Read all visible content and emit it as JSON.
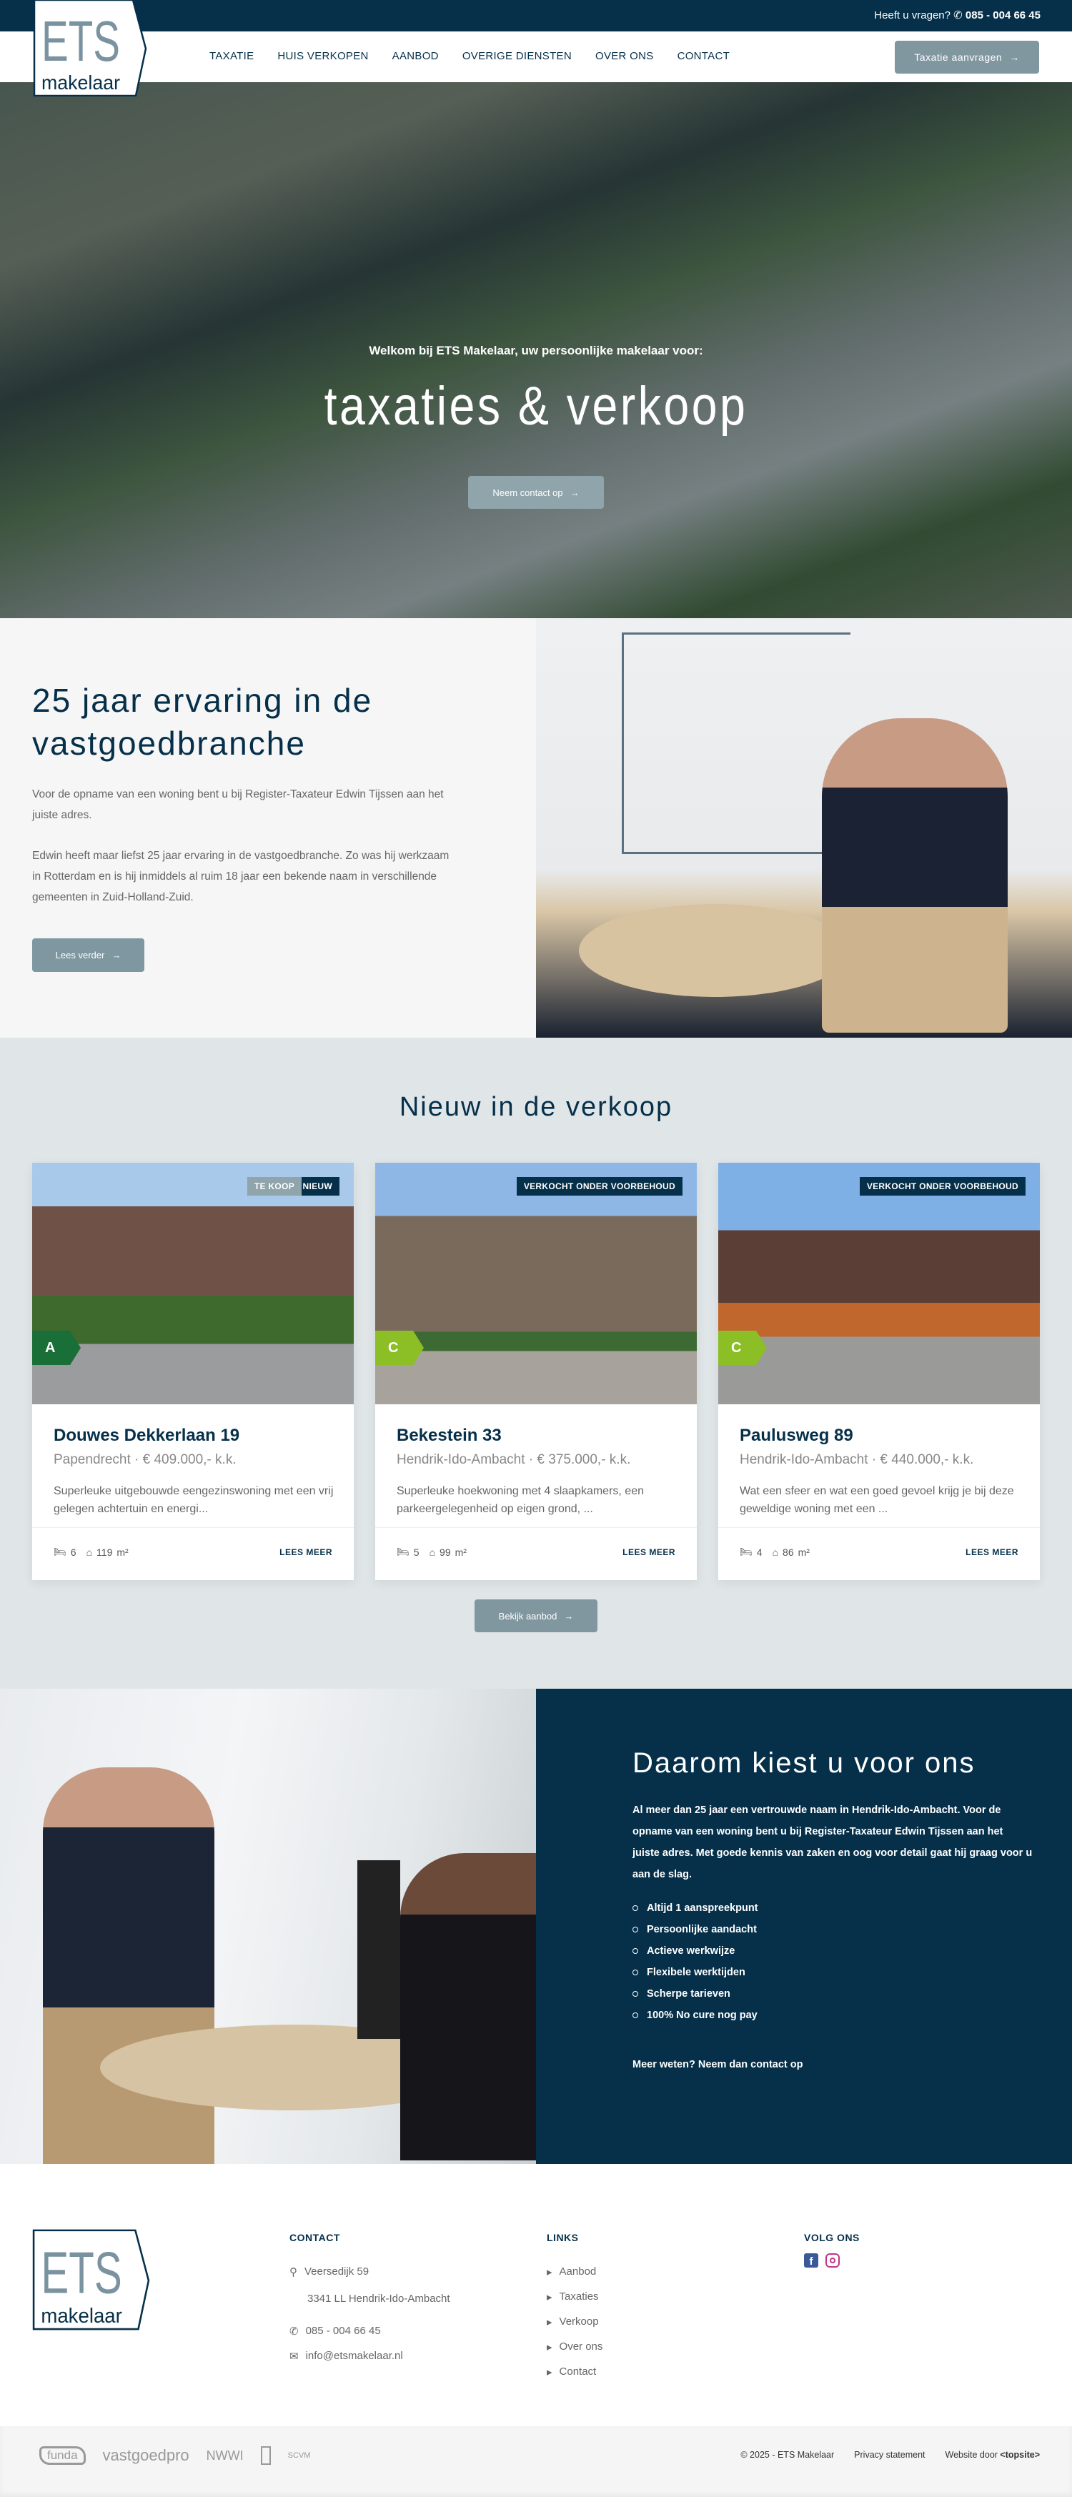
{
  "topbar": {
    "question": "Heeft u vragen?",
    "phone": "085 - 004 66 45"
  },
  "logo": {
    "big": "ETS",
    "small": "makelaar"
  },
  "nav": {
    "items": [
      "TAXATIE",
      "HUIS VERKOPEN",
      "AANBOD",
      "OVERIGE DIENSTEN",
      "OVER ONS",
      "CONTACT"
    ],
    "cta": "Taxatie aanvragen"
  },
  "hero": {
    "subtitle": "Welkom bij ETS Makelaar, uw persoonlijke makelaar voor:",
    "title": "taxaties & verkoop",
    "button": "Neem contact op"
  },
  "about": {
    "title": "25 jaar ervaring in de vastgoedbranche",
    "p1": "Voor de opname van een woning bent u bij Register-Taxateur Edwin Tijssen aan het juiste adres.",
    "p2": "Edwin heeft maar liefst 25 jaar ervaring in de vastgoedbranche. Zo was hij werkzaam in Rotterdam en is hij inmiddels al ruim 18 jaar een bekende naam in verschillende gemeenten in Zuid-Holland-Zuid.",
    "button": "Lees verder"
  },
  "listings": {
    "title": "Nieuw in de verkoop",
    "button": "Bekijk aanbod",
    "more_label": "LEES MEER",
    "area_unit": "m²",
    "items": [
      {
        "street": "Douwes Dekkerlaan 19",
        "location": "Papendrecht · € 409.000,- k.k.",
        "description": "Superleuke uitgebouwde eengezinswoning met een vrij gelegen achtertuin en energi...",
        "bedrooms": "6",
        "area": "119",
        "energy": "A",
        "energy_color": "#1a6e37",
        "tags": [
          "TE KOOP",
          "NIEUW"
        ]
      },
      {
        "street": "Bekestein 33",
        "location": "Hendrik-Ido-Ambacht · € 375.000,- k.k.",
        "description": "Superleuke hoekwoning met 4 slaapkamers, een parkeergelegenheid op eigen grond, ...",
        "bedrooms": "5",
        "area": "99",
        "energy": "C",
        "energy_color": "#8cbf26",
        "tags": [
          "VERKOCHT ONDER VOORBEHOUD"
        ]
      },
      {
        "street": "Paulusweg 89",
        "location": "Hendrik-Ido-Ambacht · € 440.000,- k.k.",
        "description": "Wat een sfeer en wat een goed gevoel krijg je bij deze geweldige woning met een ...",
        "bedrooms": "4",
        "area": "86",
        "energy": "C",
        "energy_color": "#8cbf26",
        "tags": [
          "VERKOCHT ONDER VOORBEHOUD"
        ]
      }
    ]
  },
  "why": {
    "title": "Daarom kiest u voor ons",
    "text": "Al meer dan 25 jaar een vertrouwde naam in Hendrik-Ido-Ambacht. Voor de opname van een woning bent u bij Register-Taxateur Edwin Tijssen aan het juiste adres. Met goede kennis van zaken en oog voor detail gaat hij graag voor u aan de slag.",
    "bullets": [
      "Altijd 1 aanspreekpunt",
      "Persoonlijke aandacht",
      "Actieve werkwijze",
      "Flexibele werktijden",
      "Scherpe tarieven",
      "100% No cure nog pay"
    ],
    "more": "Meer weten? Neem dan contact op"
  },
  "footer": {
    "contact": {
      "title": "CONTACT",
      "street": "Veersedijk 59",
      "city": "3341 LL Hendrik-Ido-Ambacht",
      "phone": "085 - 004 66 45",
      "email": "info@etsmakelaar.nl"
    },
    "links": {
      "title": "LINKS",
      "items": [
        "Aanbod",
        "Taxaties",
        "Verkoop",
        "Over ons",
        "Contact"
      ]
    },
    "social": {
      "title": "VOLG ONS",
      "facebook_color": "#3b5998",
      "instagram_color": "#c13584"
    },
    "partners": [
      "funda",
      "vastgoedpro",
      "NWWI",
      "SCVM"
    ],
    "copyright": "© 2025 - ETS Makelaar",
    "privacy": "Privacy statement",
    "credit": "Website door",
    "credit_brand": "<topsite>"
  },
  "colors": {
    "primary": "#06304a",
    "button": "#8197a0",
    "section_bg": "#e0e6e8"
  }
}
